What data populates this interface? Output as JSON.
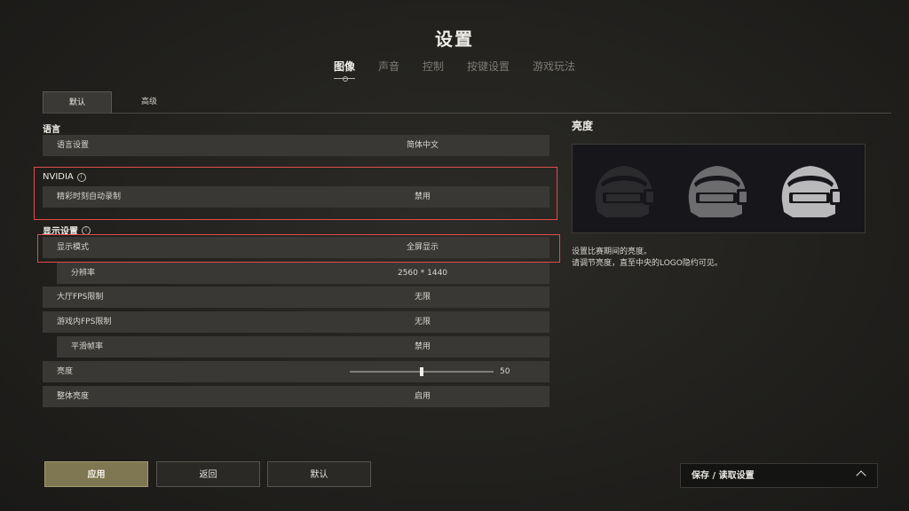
{
  "title": "设置",
  "tabs": [
    {
      "label": "图像",
      "active": true
    },
    {
      "label": "声音"
    },
    {
      "label": "控制"
    },
    {
      "label": "按键设置"
    },
    {
      "label": "游戏玩法"
    }
  ],
  "subtabs": {
    "default": "默认",
    "advanced": "高级"
  },
  "sections": {
    "language": "语言",
    "nvidia": "NVIDIA",
    "display": "显示设置"
  },
  "rows": {
    "language_setting": {
      "label": "语言设置",
      "value": "简体中文"
    },
    "highlights_record": {
      "label": "精彩时刻自动录制",
      "value": "禁用"
    },
    "display_mode": {
      "label": "显示模式",
      "value": "全屏显示"
    },
    "resolution": {
      "label": "分辨率",
      "value": "2560 * 1440"
    },
    "lobby_fps": {
      "label": "大厅FPS限制",
      "value": "无限"
    },
    "ingame_fps": {
      "label": "游戏内FPS限制",
      "value": "无限"
    },
    "smooth_framerate": {
      "label": "平滑帧率",
      "value": "禁用"
    },
    "brightness": {
      "label": "亮度",
      "value": "50",
      "level": 0.5
    },
    "overall_brightness": {
      "label": "整体亮度",
      "value": "启用"
    }
  },
  "info_icon": "info-icon",
  "side": {
    "title": "亮度",
    "desc_line1": "设置比赛期间的亮度。",
    "desc_line2": "请调节亮度，直至中央的LOGO隐约可见。"
  },
  "buttons": {
    "apply": "应用",
    "back": "返回",
    "default": "默认"
  },
  "save_load": {
    "label": "保存 / 读取设置",
    "icon": "chevron-up-icon"
  },
  "colors": {
    "highlight": "#e24c4c",
    "apply": "#7f7652"
  }
}
